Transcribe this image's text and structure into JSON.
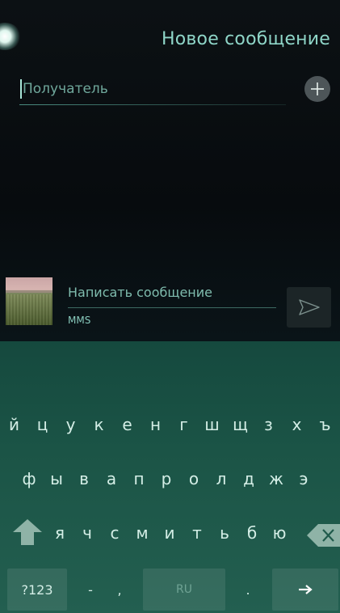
{
  "header": {
    "title": "Новое сообщение"
  },
  "recipient": {
    "placeholder": "Получатель",
    "add_icon": "plus-circle-icon"
  },
  "attachment": {
    "thumbnail_icon": "field-photo-thumbnail"
  },
  "compose": {
    "placeholder": "Написать сообщение",
    "type_label": "MMS",
    "send_icon": "send-icon"
  },
  "keyboard": {
    "row1": [
      "й",
      "ц",
      "у",
      "к",
      "е",
      "н",
      "г",
      "ш",
      "щ",
      "з",
      "х",
      "ъ"
    ],
    "row2": [
      "ф",
      "ы",
      "в",
      "а",
      "п",
      "р",
      "о",
      "л",
      "д",
      "ж",
      "э"
    ],
    "row3": [
      "я",
      "ч",
      "с",
      "м",
      "и",
      "т",
      "ь",
      "б",
      "ю"
    ],
    "shift_icon": "shift-icon",
    "backspace_icon": "backspace-icon",
    "bottom": {
      "symbols_label": "?123",
      "dash_label": "-",
      "comma_label": ",",
      "space_label": "RU",
      "period_label": ".",
      "enter_icon": "arrow-right-icon"
    }
  },
  "colors": {
    "accent": "#8fd6c8",
    "keyboard": "#1b5446",
    "background": "#0a1014"
  }
}
